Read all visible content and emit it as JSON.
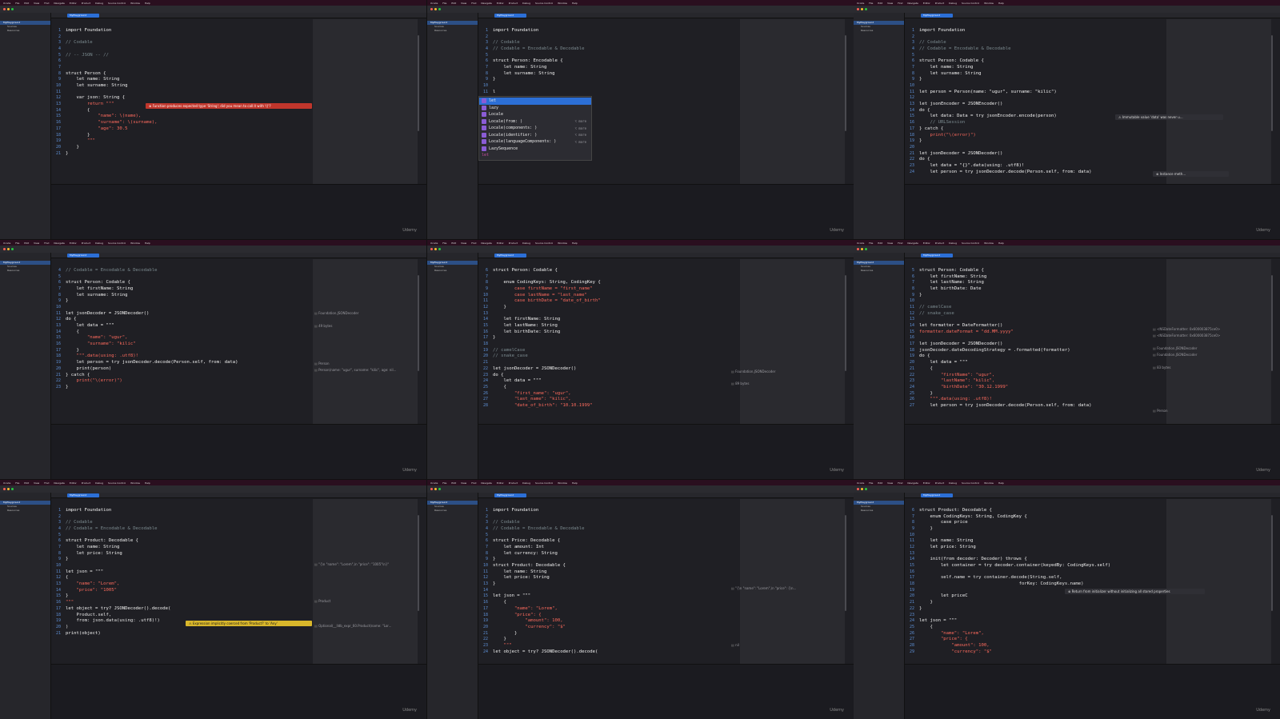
{
  "watermark": "Udemy",
  "menubar": [
    "Xcode",
    "File",
    "Edit",
    "View",
    "Find",
    "Navigate",
    "Editor",
    "Product",
    "Debug",
    "Source Control",
    "Window",
    "Help"
  ],
  "sidebar": [
    "MyPlayground",
    "Sources",
    "Resources"
  ],
  "tab_label": "MyPlayground",
  "panels": [
    {
      "lines": [
        {
          "n": "1",
          "t": "import Foundation"
        },
        {
          "n": "2",
          "t": ""
        },
        {
          "n": "3",
          "t": "// Codable"
        },
        {
          "n": "4",
          "t": ""
        },
        {
          "n": "5",
          "t": "// -- JSON -- //"
        },
        {
          "n": "6",
          "t": ""
        },
        {
          "n": "7",
          "t": ""
        },
        {
          "n": "8",
          "t": "struct Person {"
        },
        {
          "n": "9",
          "t": "    let name: String"
        },
        {
          "n": "10",
          "t": "    let surname: String"
        },
        {
          "n": "11",
          "t": ""
        },
        {
          "n": "12",
          "t": "    var json: String {"
        },
        {
          "n": "13",
          "t": "        return \"\"\""
        },
        {
          "n": "14",
          "t": "        {"
        },
        {
          "n": "15",
          "t": "            \"name\": \\(name),"
        },
        {
          "n": "16",
          "t": "            \"surname\": \\(surname),"
        },
        {
          "n": "17",
          "t": "            \"age\": 30.5"
        },
        {
          "n": "18",
          "t": "        }"
        },
        {
          "n": "19",
          "t": "        \"\"\""
        },
        {
          "n": "20",
          "t": "    }"
        },
        {
          "n": "21",
          "t": "}"
        }
      ],
      "error": "Function produces expected type 'String'; did you mean to call it with '()'?"
    },
    {
      "lines": [
        {
          "n": "1",
          "t": "import Foundation"
        },
        {
          "n": "2",
          "t": ""
        },
        {
          "n": "3",
          "t": "// Codable"
        },
        {
          "n": "4",
          "t": "// Codable = Encodable & Decodable"
        },
        {
          "n": "5",
          "t": ""
        },
        {
          "n": "6",
          "t": "struct Person: Encodable {"
        },
        {
          "n": "7",
          "t": "    let name: String"
        },
        {
          "n": "8",
          "t": "    let surname: String"
        },
        {
          "n": "9",
          "t": "}"
        },
        {
          "n": "10",
          "t": ""
        },
        {
          "n": "11",
          "t": "l"
        }
      ],
      "completions": [
        {
          "label": "let",
          "suffix": ""
        },
        {
          "label": "lazy",
          "suffix": ""
        },
        {
          "label": "Locale",
          "suffix": ""
        },
        {
          "label": "Locale(from: )",
          "suffix": "⌥ more"
        },
        {
          "label": "Locale(components: )",
          "suffix": "⌥ more"
        },
        {
          "label": "Locale(identifier: )",
          "suffix": "⌥ more"
        },
        {
          "label": "Locale(languageComponents: )",
          "suffix": "⌥ more"
        },
        {
          "label": "LazySequence",
          "suffix": ""
        }
      ],
      "completion_footer": "let"
    },
    {
      "lines": [
        {
          "n": "1",
          "t": "import Foundation"
        },
        {
          "n": "2",
          "t": ""
        },
        {
          "n": "3",
          "t": "// Codable"
        },
        {
          "n": "4",
          "t": "// Codable = Encodable & Decodable"
        },
        {
          "n": "5",
          "t": ""
        },
        {
          "n": "6",
          "t": "struct Person: Codable {"
        },
        {
          "n": "7",
          "t": "    let name: String"
        },
        {
          "n": "8",
          "t": "    let surname: String"
        },
        {
          "n": "9",
          "t": "}"
        },
        {
          "n": "10",
          "t": ""
        },
        {
          "n": "11",
          "t": "let person = Person(name: \"ugur\", surname: \"kilic\")"
        },
        {
          "n": "12",
          "t": ""
        },
        {
          "n": "13",
          "t": "let jsonEncoder = JSONEncoder()"
        },
        {
          "n": "14",
          "t": "do {"
        },
        {
          "n": "15",
          "t": "    let data: Data = try jsonEncoder.encode(person)"
        },
        {
          "n": "16",
          "t": "    // URLSession"
        },
        {
          "n": "17",
          "t": "} catch {"
        },
        {
          "n": "18",
          "t": "    print(\"\\(error)\")"
        },
        {
          "n": "19",
          "t": "}"
        },
        {
          "n": "20",
          "t": ""
        },
        {
          "n": "21",
          "t": "let jsonDecoder = JSONDecoder()"
        },
        {
          "n": "22",
          "t": "do {"
        },
        {
          "n": "23",
          "t": "    let data = \"{}\".data(using: .utf8)!"
        },
        {
          "n": "24",
          "t": "    let person = try jsonDecoder.decode(Person.self, from: data)"
        }
      ],
      "warning": "Immutable value 'data' was never u...",
      "note": "Instance meth..."
    },
    {
      "lines": [
        {
          "n": "4",
          "t": "// Codable = Encodable & Decodable"
        },
        {
          "n": "5",
          "t": ""
        },
        {
          "n": "6",
          "t": "struct Person: Codable {"
        },
        {
          "n": "7",
          "t": "    let firstName: String"
        },
        {
          "n": "8",
          "t": "    let surname: String"
        },
        {
          "n": "9",
          "t": "}"
        },
        {
          "n": "10",
          "t": ""
        },
        {
          "n": "11",
          "t": "let jsonDecoder = JSONDecoder()"
        },
        {
          "n": "12",
          "t": "do {"
        },
        {
          "n": "13",
          "t": "    let data = \"\"\""
        },
        {
          "n": "14",
          "t": "    {"
        },
        {
          "n": "15",
          "t": "        \"name\": \"ugur\","
        },
        {
          "n": "16",
          "t": "        \"surname\": \"kilic\""
        },
        {
          "n": "17",
          "t": "    }"
        },
        {
          "n": "18",
          "t": "    \"\"\".data(using: .utf8)!"
        },
        {
          "n": "19",
          "t": "    let person = try jsonDecoder.decode(Person.self, from: data)"
        },
        {
          "n": "20",
          "t": "    print(person)"
        },
        {
          "n": "21",
          "t": "} catch {"
        },
        {
          "n": "22",
          "t": "    print(\"\\(error)\")"
        },
        {
          "n": "23",
          "t": "}"
        }
      ],
      "hints": [
        "Foundation.JSONDecoder",
        "49 bytes",
        "Person",
        "Person(name: \"ugur\", surname: \"kilic\", age: nil..."
      ]
    },
    {
      "lines": [
        {
          "n": "6",
          "t": "struct Person: Codable {"
        },
        {
          "n": "7",
          "t": ""
        },
        {
          "n": "8",
          "t": "    enum CodingKeys: String, CodingKey {"
        },
        {
          "n": "9",
          "t": "        case firstName = \"first_name\""
        },
        {
          "n": "10",
          "t": "        case lastName = \"last_name\""
        },
        {
          "n": "11",
          "t": "        case birthDate = \"date_of_birth\""
        },
        {
          "n": "12",
          "t": "    }"
        },
        {
          "n": "13",
          "t": ""
        },
        {
          "n": "14",
          "t": "    let firstName: String"
        },
        {
          "n": "15",
          "t": "    let lastName: String"
        },
        {
          "n": "16",
          "t": "    let birthDate: String"
        },
        {
          "n": "17",
          "t": "}"
        },
        {
          "n": "18",
          "t": ""
        },
        {
          "n": "19",
          "t": "// camelCase"
        },
        {
          "n": "20",
          "t": "// snake_case"
        },
        {
          "n": "21",
          "t": ""
        },
        {
          "n": "22",
          "t": "let jsonDecoder = JSONDecoder()"
        },
        {
          "n": "23",
          "t": "do {"
        },
        {
          "n": "24",
          "t": "    let data = \"\"\""
        },
        {
          "n": "25",
          "t": "    {"
        },
        {
          "n": "26",
          "t": "        \"first_name\": \"ugur\","
        },
        {
          "n": "27",
          "t": "        \"last_name\": \"kilic\","
        },
        {
          "n": "28",
          "t": "        \"date_of_birth\": \"10.10.1999\""
        }
      ],
      "hints": [
        "Foundation.JSONDecoder",
        "89 bytes"
      ]
    },
    {
      "lines": [
        {
          "n": "5",
          "t": "struct Person: Codable {"
        },
        {
          "n": "6",
          "t": "    let firstName: String"
        },
        {
          "n": "7",
          "t": "    let lastName: String"
        },
        {
          "n": "8",
          "t": "    let birthDate: Date"
        },
        {
          "n": "9",
          "t": "}"
        },
        {
          "n": "10",
          "t": ""
        },
        {
          "n": "11",
          "t": "// camelCase"
        },
        {
          "n": "12",
          "t": "// snake_case"
        },
        {
          "n": "13",
          "t": ""
        },
        {
          "n": "14",
          "t": "let formatter = DateFormatter()"
        },
        {
          "n": "15",
          "t": "formatter.dateFormat = \"dd.MM.yyyy\""
        },
        {
          "n": "16",
          "t": ""
        },
        {
          "n": "17",
          "t": "let jsonDecoder = JSONDecoder()"
        },
        {
          "n": "18",
          "t": "jsonDecoder.dateDecodingStrategy = .formatted(formatter)"
        },
        {
          "n": "19",
          "t": "do {"
        },
        {
          "n": "20",
          "t": "    let data = \"\"\""
        },
        {
          "n": "21",
          "t": "    {"
        },
        {
          "n": "22",
          "t": "        \"firstName\": \"ugur\","
        },
        {
          "n": "23",
          "t": "        \"lastName\": \"kilic\","
        },
        {
          "n": "24",
          "t": "        \"birthDate\": \"30.12.1999\""
        },
        {
          "n": "25",
          "t": "    }"
        },
        {
          "n": "26",
          "t": "    \"\"\".data(using: .utf8)!"
        },
        {
          "n": "27",
          "t": "    let person = try jsonDecoder.decode(Person.self, from: data)"
        }
      ],
      "hints": [
        "<NSDateFormatter: 0x600003875ce0>",
        "<NSDateFormatter: 0x600003875ce0>",
        "Foundation.JSONDecoder",
        "Foundation.JSONDecoder",
        "83 bytes",
        "Person"
      ]
    },
    {
      "lines": [
        {
          "n": "1",
          "t": "import Foundation"
        },
        {
          "n": "2",
          "t": ""
        },
        {
          "n": "3",
          "t": "// Codable"
        },
        {
          "n": "4",
          "t": "// Codable = Encodable & Decodable"
        },
        {
          "n": "5",
          "t": ""
        },
        {
          "n": "6",
          "t": "struct Product: Decodable {"
        },
        {
          "n": "7",
          "t": "    let name: String"
        },
        {
          "n": "8",
          "t": "    let price: String"
        },
        {
          "n": "9",
          "t": "}"
        },
        {
          "n": "10",
          "t": ""
        },
        {
          "n": "11",
          "t": "let json = \"\"\""
        },
        {
          "n": "12",
          "t": "{"
        },
        {
          "n": "13",
          "t": "    \"name\": \"Lorem\","
        },
        {
          "n": "14",
          "t": "    \"price\": \"1005\""
        },
        {
          "n": "15",
          "t": "}"
        },
        {
          "n": "16",
          "t": "\"\"\""
        },
        {
          "n": "17",
          "t": "let object = try? JSONDecoder().decode("
        },
        {
          "n": "18",
          "t": "    Product.self,"
        },
        {
          "n": "19",
          "t": "    from: json.data(using: .utf8)!)"
        },
        {
          "n": "20",
          "t": ")"
        },
        {
          "n": "21",
          "t": "print(object)"
        }
      ],
      "warning": "Expression implicitly coerced from 'Product?' to 'Any'",
      "hints": [
        "\"{\\n  \"name\": \"Lorem\",\\n  \"price\": \"1005\"\\n}\"",
        "Product",
        "Optional(__lldb_expr_60.Product(name: \"Lor..."
      ]
    },
    {
      "lines": [
        {
          "n": "1",
          "t": "import Foundation"
        },
        {
          "n": "2",
          "t": ""
        },
        {
          "n": "3",
          "t": "// Codable"
        },
        {
          "n": "4",
          "t": "// Codable = Encodable & Decodable"
        },
        {
          "n": "5",
          "t": ""
        },
        {
          "n": "6",
          "t": "struct Price: Decodable {"
        },
        {
          "n": "7",
          "t": "    let amount: Int"
        },
        {
          "n": "8",
          "t": "    let currency: String"
        },
        {
          "n": "9",
          "t": "}"
        },
        {
          "n": "10",
          "t": "struct Product: Decodable {"
        },
        {
          "n": "11",
          "t": "    let name: String"
        },
        {
          "n": "12",
          "t": "    let price: String"
        },
        {
          "n": "13",
          "t": "}"
        },
        {
          "n": "14",
          "t": ""
        },
        {
          "n": "15",
          "t": "let json = \"\"\""
        },
        {
          "n": "16",
          "t": "    {"
        },
        {
          "n": "17",
          "t": "        \"name\": \"Lorem\","
        },
        {
          "n": "18",
          "t": "        \"price\": {"
        },
        {
          "n": "19",
          "t": "            \"amount\": 100,"
        },
        {
          "n": "20",
          "t": "            \"currency\": \"$\""
        },
        {
          "n": "21",
          "t": "        }"
        },
        {
          "n": "22",
          "t": "    }"
        },
        {
          "n": "23",
          "t": "    \"\"\""
        },
        {
          "n": "24",
          "t": "let object = try? JSONDecoder().decode("
        }
      ],
      "hints": [
        "\"{\\n  \"name\": \"Lorem\",\\n  \"price\": {\\n...",
        "nil"
      ]
    },
    {
      "lines": [
        {
          "n": "6",
          "t": "struct Product: Decodable {"
        },
        {
          "n": "7",
          "t": "    enum CodingKeys: String, CodingKey {"
        },
        {
          "n": "8",
          "t": "        case price"
        },
        {
          "n": "9",
          "t": "    }"
        },
        {
          "n": "10",
          "t": ""
        },
        {
          "n": "11",
          "t": "    let name: String"
        },
        {
          "n": "12",
          "t": "    let price: String"
        },
        {
          "n": "13",
          "t": ""
        },
        {
          "n": "14",
          "t": "    init(from decoder: Decoder) throws {"
        },
        {
          "n": "15",
          "t": "        let container = try decoder.container(keyedBy: CodingKeys.self)"
        },
        {
          "n": "16",
          "t": ""
        },
        {
          "n": "17",
          "t": "        self.name = try container.decode(String.self,"
        },
        {
          "n": "18",
          "t": "                                     forKey: CodingKeys.name)"
        },
        {
          "n": "19",
          "t": ""
        },
        {
          "n": "20",
          "t": "        let priceC"
        },
        {
          "n": "21",
          "t": "    }"
        },
        {
          "n": "22",
          "t": "}"
        },
        {
          "n": "23",
          "t": ""
        },
        {
          "n": "24",
          "t": "let json = \"\"\""
        },
        {
          "n": "25",
          "t": "    {"
        },
        {
          "n": "26",
          "t": "        \"name\": \"Lorem\","
        },
        {
          "n": "27",
          "t": "        \"price\": {"
        },
        {
          "n": "28",
          "t": "            \"amount\": 100,"
        },
        {
          "n": "29",
          "t": "            \"currency\": \"$\""
        }
      ],
      "note": "Return from initializer without initializing all stored properties"
    }
  ]
}
